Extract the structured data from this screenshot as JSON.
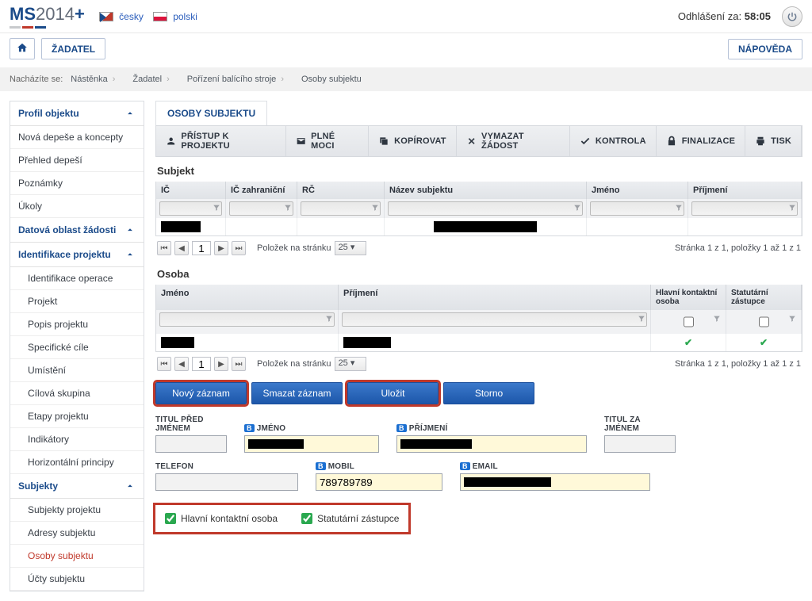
{
  "header": {
    "logo_a": "MS",
    "logo_b": "2014",
    "logo_c": "+",
    "lang_cs": "česky",
    "lang_pl": "polski",
    "logout_label": "Odhlášení za:",
    "logout_time": "58:05"
  },
  "nav": {
    "zadatel": "ŽADATEL",
    "help": "NÁPOVĚDA"
  },
  "breadcrumb": {
    "label": "Nacházíte se:",
    "items": [
      "Nástěnka",
      "Žadatel",
      "Pořízení balícího stroje",
      "Osoby subjektu"
    ]
  },
  "sidebar": {
    "g1": "Profil objektu",
    "g1_items": [
      "Nová depeše a koncepty",
      "Přehled depeší",
      "Poznámky",
      "Úkoly"
    ],
    "g2": "Datová oblast žádosti",
    "g3": "Identifikace projektu",
    "g3_items": [
      "Identifikace operace",
      "Projekt",
      "Popis projektu",
      "Specifické cíle",
      "Umístění",
      "Cílová skupina",
      "Etapy projektu",
      "Indikátory",
      "Horizontální principy"
    ],
    "g4": "Subjekty",
    "g4_items": [
      "Subjekty projektu",
      "Adresy subjektu",
      "Osoby subjektu",
      "Účty subjektu"
    ]
  },
  "main": {
    "tab": "OSOBY SUBJEKTU",
    "toolbar": {
      "access": "PŘÍSTUP K PROJEKTU",
      "plne": "PLNÉ MOCI",
      "copy": "KOPÍROVAT",
      "delete": "VYMAZAT ŽÁDOST",
      "check": "KONTROLA",
      "finalize": "FINALIZACE",
      "print": "TISK"
    },
    "subjectTitle": "Subjekt",
    "subjectCols": [
      "IČ",
      "IČ zahraniční",
      "RČ",
      "Název subjektu",
      "Jméno",
      "Příjmení"
    ],
    "osobaTitle": "Osoba",
    "osobaCols": [
      "Jméno",
      "Příjmení",
      "Hlavní kontaktní osoba",
      "Statutární zástupce"
    ],
    "pager": {
      "perPageLabel": "Položek na stránku",
      "perPage": "25",
      "page": "1",
      "info1": "Stránka 1 z 1, položky 1 až 1 z 1"
    },
    "buttons": {
      "new": "Nový záznam",
      "delete": "Smazat záznam",
      "save": "Uložit",
      "cancel": "Storno"
    },
    "form": {
      "titulpred": "TITUL PŘED JMÉNEM",
      "jmeno": "JMÉNO",
      "prijmeni": "PŘÍJMENÍ",
      "titulza": "TITUL ZA JMÉNEM",
      "telefon": "TELEFON",
      "mobil": "MOBIL",
      "mobil_val": "789789789",
      "email": "EMAIL",
      "hlavni": "Hlavní kontaktní osoba",
      "statut": "Statutární zástupce"
    }
  }
}
